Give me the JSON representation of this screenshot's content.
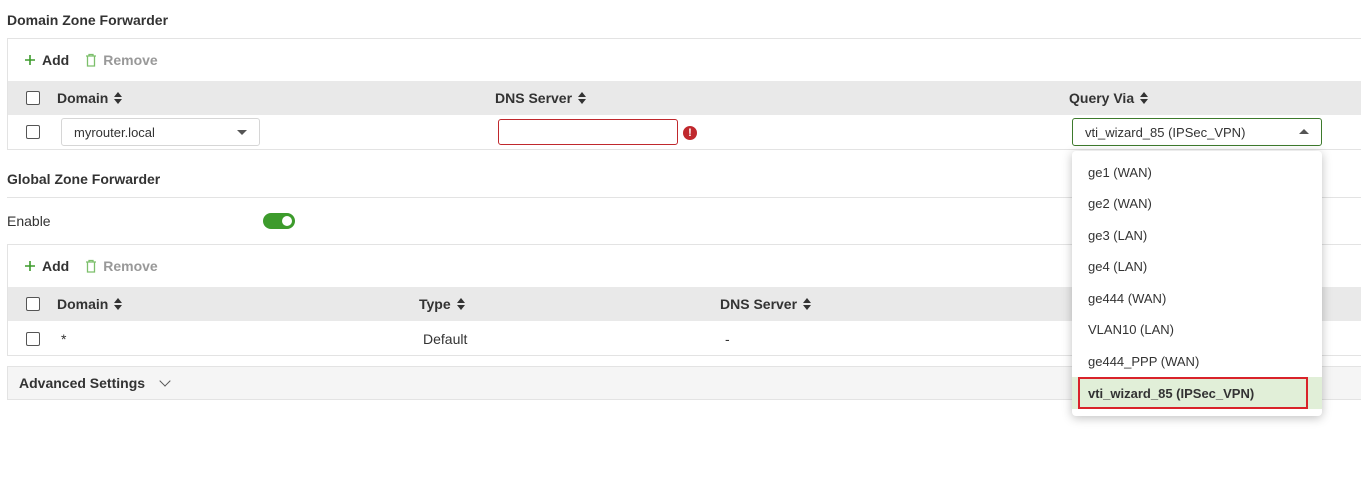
{
  "domain_zone": {
    "title": "Domain Zone Forwarder",
    "toolbar": {
      "add_label": "Add",
      "remove_label": "Remove"
    },
    "columns": {
      "domain": "Domain",
      "dns_server": "DNS Server",
      "query_via": "Query Via"
    },
    "row": {
      "domain_value": "myrouter.local",
      "dns_server_value": "",
      "error_icon": "!",
      "query_via_value": "vti_wizard_85 (IPSec_VPN)"
    }
  },
  "query_via_dropdown": {
    "options": [
      "ge1 (WAN)",
      "ge2 (WAN)",
      "ge3 (LAN)",
      "ge4 (LAN)",
      "ge444 (WAN)",
      "VLAN10 (LAN)",
      "ge444_PPP (WAN)",
      "vti_wizard_85 (IPSec_VPN)"
    ],
    "selected": "vti_wizard_85 (IPSec_VPN)"
  },
  "global_zone": {
    "title": "Global Zone Forwarder",
    "enable_label": "Enable",
    "enabled": true,
    "toolbar": {
      "add_label": "Add",
      "remove_label": "Remove"
    },
    "columns": {
      "domain": "Domain",
      "type": "Type",
      "dns_server": "DNS Server"
    },
    "rows": [
      {
        "domain": "*",
        "type": "Default",
        "dns_server": "-"
      }
    ]
  },
  "advanced_settings": {
    "label": "Advanced Settings"
  },
  "icons": {
    "add": "plus-icon",
    "remove": "trash-icon",
    "error": "error-circle-icon",
    "expand": "chevron-down-icon",
    "sort": "sort-icon"
  },
  "colors": {
    "accent_green": "#3d9b2c",
    "error_red": "#c0282d",
    "selected_bg": "#e1efd8",
    "header_bg": "#e9e9e9"
  }
}
